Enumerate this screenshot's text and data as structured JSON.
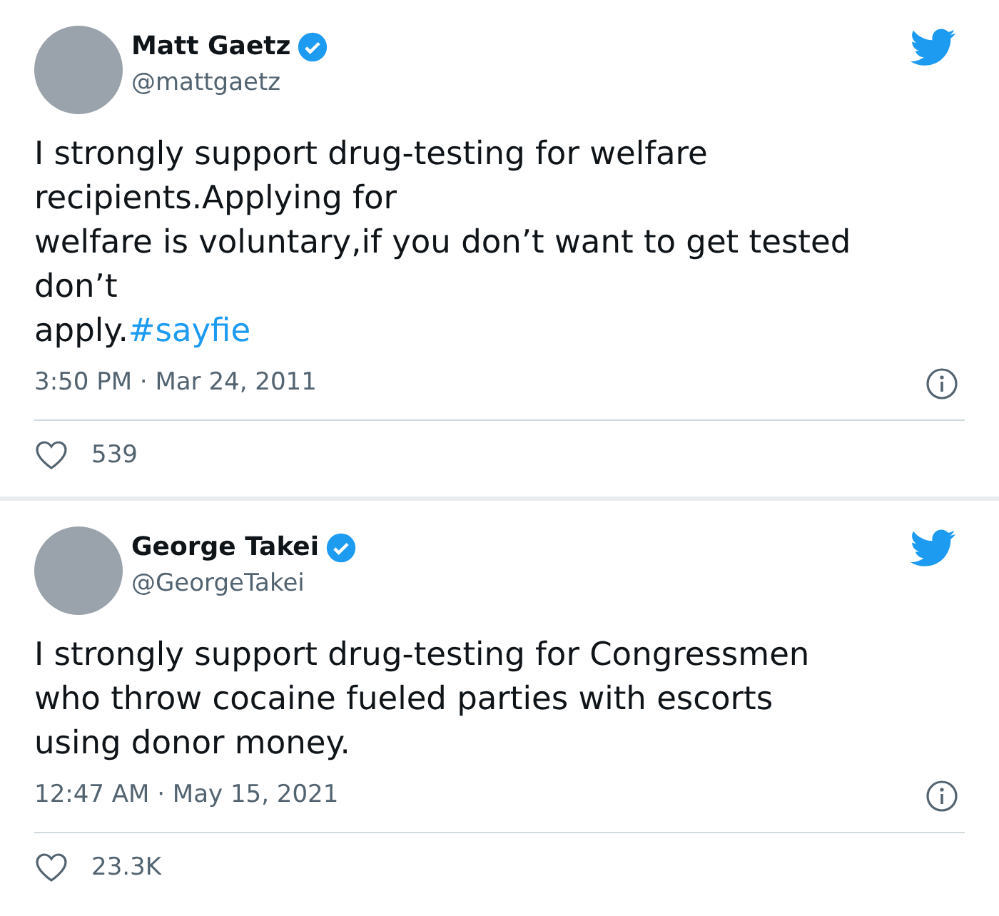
{
  "tweets": [
    {
      "name": "Matt Gaetz",
      "verified": true,
      "handle": "@mattgaetz",
      "text": "I strongly support drug-testing for welfare\nrecipients.Applying for\nwelfare is voluntary,if you don’t want to get tested\ndon’t\napply.",
      "hashtag": "#sayfie",
      "time": "3:50 PM · Mar 24, 2011",
      "likes": "539"
    },
    {
      "name": "George Takei",
      "verified": true,
      "handle": "@GeorgeTakei",
      "text": "I strongly support drug-testing for Congressmen\nwho throw cocaine fueled parties with escorts\nusing donor money.",
      "time": "12:47 AM · May 15, 2021",
      "likes": "23.3K"
    }
  ]
}
